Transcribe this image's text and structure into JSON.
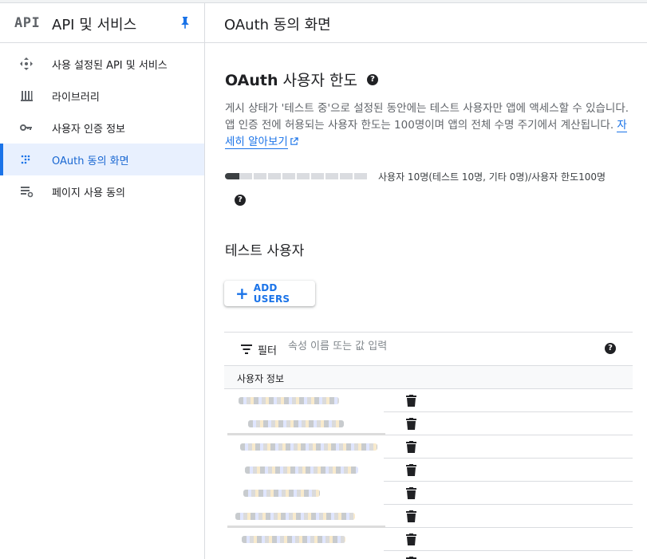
{
  "sidebar": {
    "logo": "API",
    "title": "API 및 서비스",
    "items": [
      {
        "label": "사용 설정된 API 및 서비스",
        "icon": "diamond-arrows-icon"
      },
      {
        "label": "라이브러리",
        "icon": "library-icon"
      },
      {
        "label": "사용자 인증 정보",
        "icon": "key-icon"
      },
      {
        "label": "OAuth 동의 화면",
        "icon": "dots-grid-icon",
        "active": true
      },
      {
        "label": "페이지 사용 동의",
        "icon": "settings-list-icon"
      }
    ]
  },
  "header": {
    "title": "OAuth 동의 화면"
  },
  "user_cap": {
    "title_bold": "OAuth",
    "title_rest": " 사용자 한도",
    "description": "게시 상태가 '테스트 중'으로 설정된 동안에는 테스트 사용자만 앱에 액세스할 수 있습니다. 앱 인증 전에 허용되는 사용자 한도는 100명이며 앱의 전체 수명 주기에서 계산됩니다. ",
    "learn_more": "자세히 알아보기",
    "usage_text": "사용자 10명(테스트 10명, 기타 0명)/사용자 한도100명",
    "usage_fraction": 0.1
  },
  "test_users": {
    "title": "테스트 사용자",
    "add_button": "ADD USERS",
    "filter_label": "필터",
    "filter_placeholder": "속성 이름 또는 값 입력",
    "column_header": "사용자 정보"
  },
  "colors": {
    "accent": "#1a73e8",
    "active_bg": "#e8f0fe"
  }
}
